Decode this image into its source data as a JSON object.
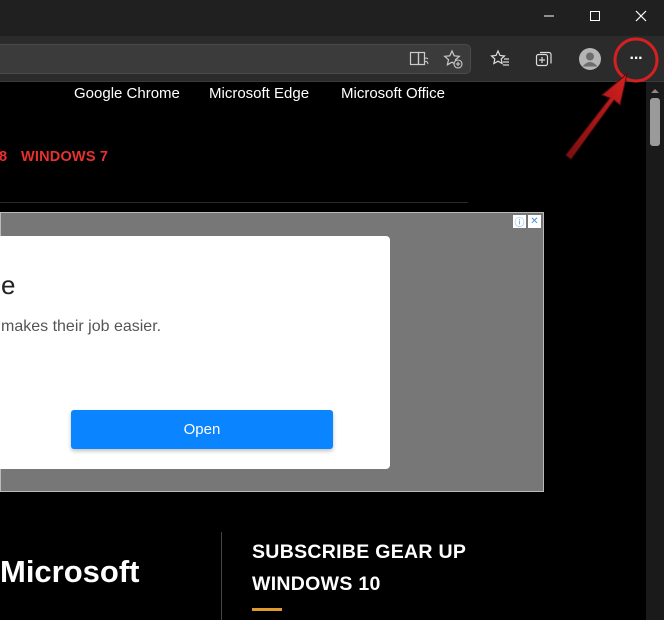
{
  "window": {
    "controls": {
      "minimize_icon": "minimize-icon",
      "maximize_icon": "maximize-icon",
      "close_icon": "close-icon"
    }
  },
  "toolbar": {
    "icons": [
      "immersive-reader-icon",
      "add-favorite-icon",
      "favorites-icon",
      "collections-icon",
      "profile-icon",
      "more-menu-icon"
    ],
    "more_label": "···"
  },
  "site": {
    "nav": [
      "Google Chrome",
      "Microsoft Edge",
      "Microsoft Office"
    ],
    "categories": [
      "8",
      "WINDOWS 7"
    ],
    "category_color": "#e8312f"
  },
  "ad": {
    "title": "e",
    "text": "makes their job easier.",
    "button": "Open",
    "choices": [
      "ⓘ",
      "✕"
    ],
    "button_color": "#0a84ff"
  },
  "footer": {
    "brand": "Microsoft",
    "subscribe_line1": "SUBSCRIBE GEAR UP",
    "subscribe_line2": "WINDOWS 10",
    "accent": "#e09b2d"
  },
  "annotation": {
    "color": "#d42020",
    "target": "more-menu-icon"
  }
}
